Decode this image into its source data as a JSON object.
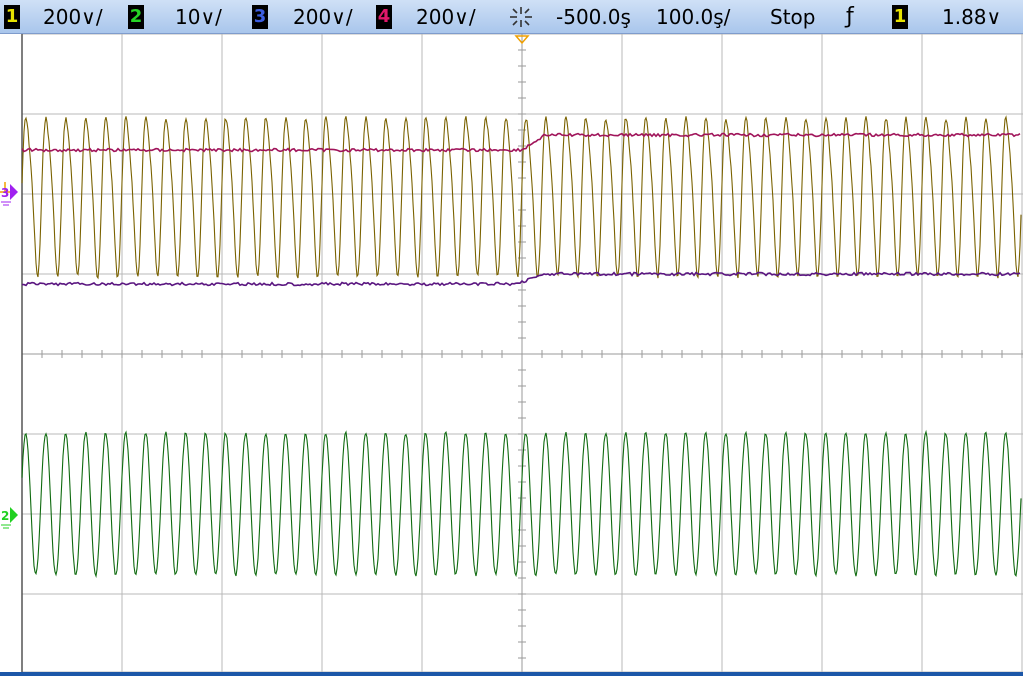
{
  "status_bar": {
    "ch1": {
      "num": "1",
      "scale": "200∨/",
      "color": "#e7e300"
    },
    "ch2": {
      "num": "2",
      "scale": "10∨/",
      "color": "#26d426"
    },
    "ch3": {
      "num": "3",
      "scale": "200∨/",
      "color": "#3c5ee0"
    },
    "ch4": {
      "num": "4",
      "scale": "200∨/",
      "color": "#e0186a"
    },
    "delay": "-500.0ş",
    "timebase": "100.0ş/",
    "run_state": "Stop",
    "trigger_edge": "ƒ",
    "trigger_source": "1",
    "trigger_level": "1.88∨"
  },
  "markers": {
    "ch3_marker": "3",
    "ch2_marker": "2",
    "ch2_color": "#22d022",
    "ch3_color": "#a020f0",
    "trigger_point_color": "#f0a000"
  },
  "waveform_colors": {
    "ch1": "#7a6200",
    "ch2": "#0f6b0f",
    "ch3": "#5a1680",
    "ch4": "#a0145a",
    "grid": "#b8b8b8",
    "center": "#9a9a9a"
  }
}
